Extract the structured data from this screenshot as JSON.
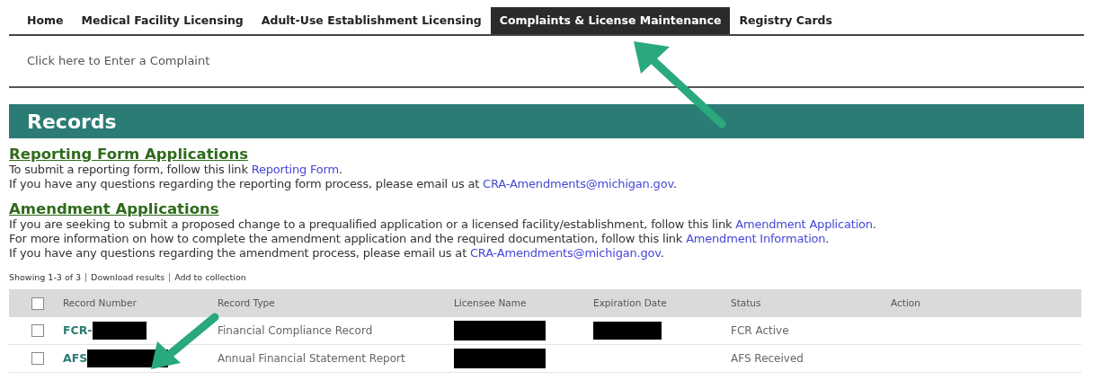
{
  "tabs": [
    {
      "label": "Home",
      "selected": false
    },
    {
      "label": "Medical Facility Licensing",
      "selected": false
    },
    {
      "label": "Adult-Use Establishment Licensing",
      "selected": false
    },
    {
      "label": "Complaints & License Maintenance",
      "selected": true
    },
    {
      "label": "Registry Cards",
      "selected": false
    }
  ],
  "complaint_link": "Click here to Enter a Complaint",
  "section_title": "Records",
  "info_blocks": [
    {
      "heading": "Reporting Form Applications",
      "lines": [
        [
          {
            "text": "To submit a reporting form, follow this link "
          },
          {
            "text": "Reporting Form",
            "link": true
          },
          {
            "text": "."
          }
        ],
        [
          {
            "text": "If you have any questions regarding the reporting form process, please email us at "
          },
          {
            "text": "CRA-Amendments@michigan.gov",
            "link": true
          },
          {
            "text": "."
          }
        ]
      ]
    },
    {
      "heading": "Amendment Applications",
      "lines": [
        [
          {
            "text": "If you are seeking to submit a proposed change to a prequalified application or a licensed facility/establishment, follow this link "
          },
          {
            "text": "Amendment Application",
            "link": true
          },
          {
            "text": "."
          }
        ],
        [
          {
            "text": "For more information on how to complete the amendment application and the required documentation, follow this link "
          },
          {
            "text": "Amendment Information",
            "link": true
          },
          {
            "text": "."
          }
        ],
        [
          {
            "text": "If you have any questions regarding the amendment process, please email us at "
          },
          {
            "text": "CRA-Amendments@michigan.gov",
            "link": true
          },
          {
            "text": "."
          }
        ]
      ]
    }
  ],
  "results": {
    "showing": "Showing 1-3 of 3",
    "actions": [
      "Download results",
      "Add to collection"
    ]
  },
  "table": {
    "select_all_checked": false,
    "columns": [
      "Record Number",
      "Record Type",
      "Licensee Name",
      "Expiration Date",
      "Status",
      "Action"
    ],
    "rows": [
      {
        "checked": false,
        "record_number": "FCR-",
        "record_type": "Financial Compliance Record",
        "licensee_redacted": true,
        "expiration_redacted": true,
        "status": "FCR Active"
      },
      {
        "checked": false,
        "record_number": "AFS",
        "record_type": "Annual Financial Statement Report",
        "licensee_redacted": true,
        "expiration_redacted": false,
        "status": "AFS Received"
      }
    ]
  }
}
